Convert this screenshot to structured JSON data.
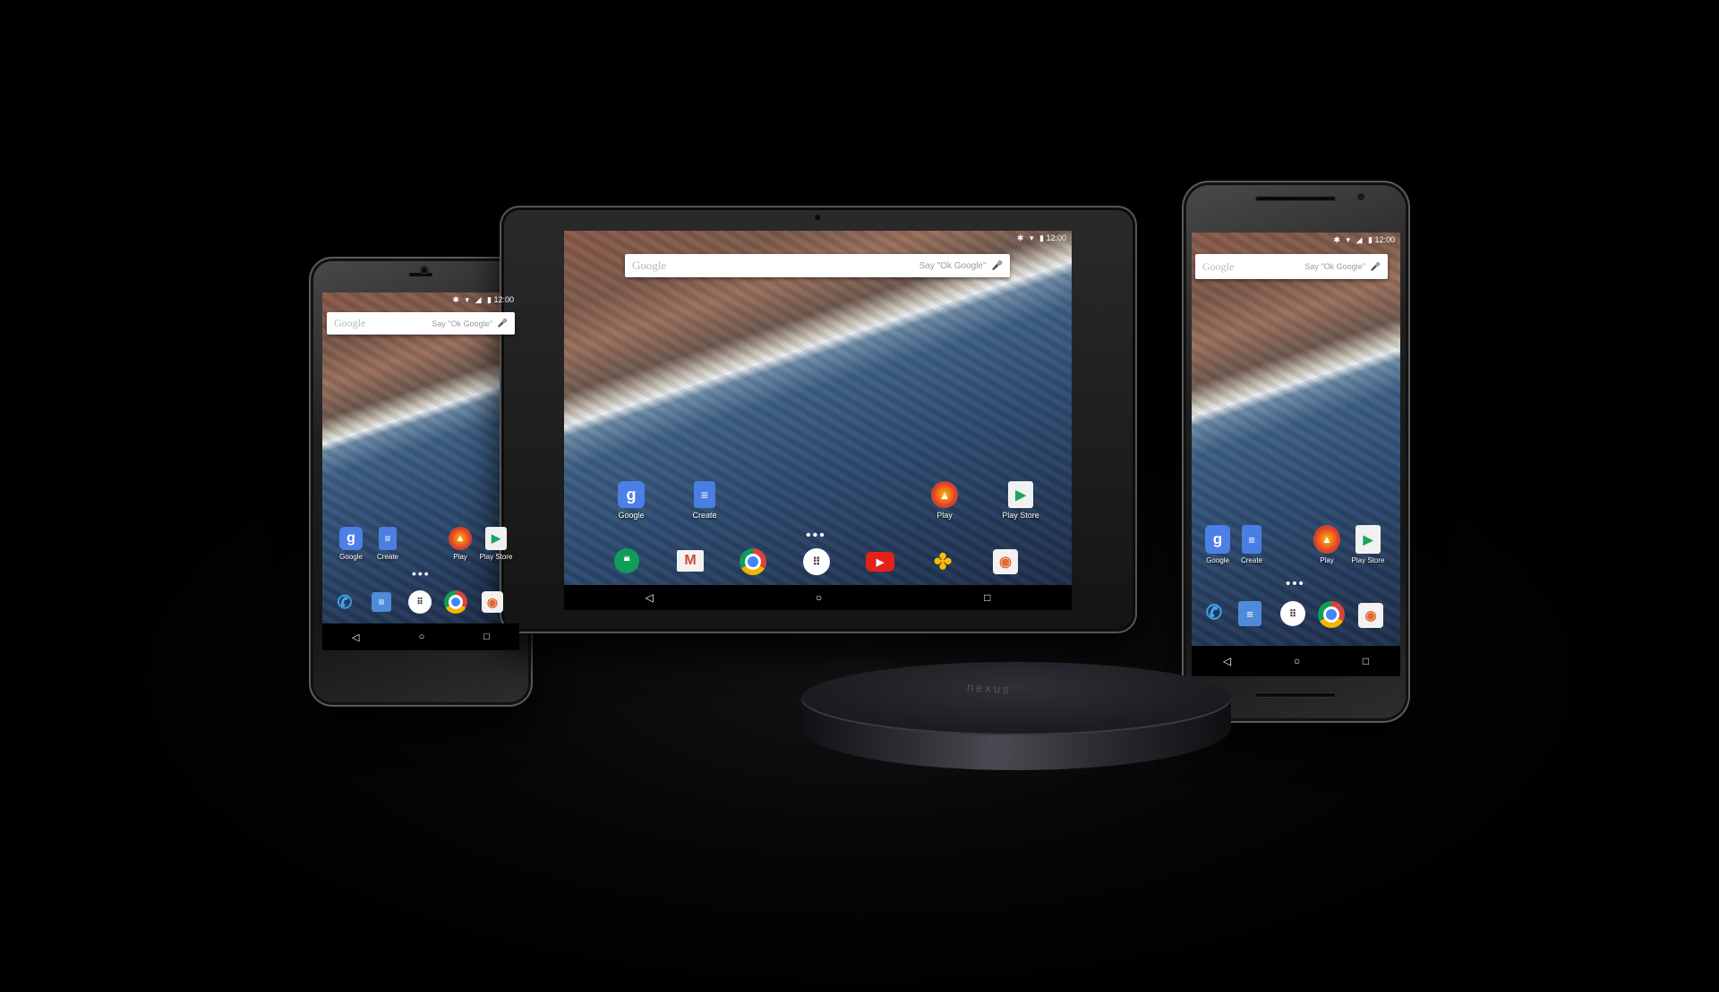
{
  "status_time": "12:00",
  "search": {
    "logo": "Google",
    "hint": "Say \"Ok Google\""
  },
  "home_apps": [
    {
      "label": "Google",
      "icon": "google-search-icon"
    },
    {
      "label": "Create",
      "icon": "docs-icon"
    },
    {
      "label": "Play",
      "icon": "play-games-icon"
    },
    {
      "label": "Play Store",
      "icon": "play-store-icon"
    }
  ],
  "phone_dock": [
    "phone-icon",
    "messenger-icon",
    "app-drawer-icon",
    "chrome-icon",
    "camera-icon"
  ],
  "tablet_dock": [
    "hangouts-icon",
    "gmail-icon",
    "chrome-icon",
    "app-drawer-icon",
    "youtube-icon",
    "photos-icon",
    "camera-icon"
  ],
  "nav": {
    "back": "◁",
    "home": "○",
    "recents": "□"
  },
  "player": {
    "logo": "nexus"
  },
  "colors": {
    "background": "#000000",
    "sea": "#2e4c71",
    "land": "#8a5a4a"
  }
}
